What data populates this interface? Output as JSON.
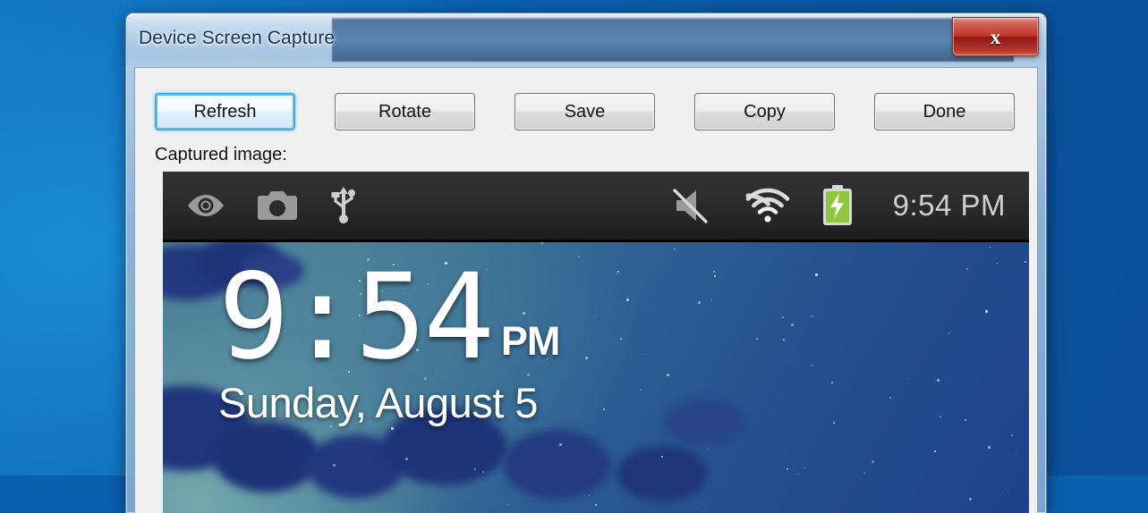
{
  "window": {
    "title": "Device Screen Capture",
    "close_label": "x",
    "close_icon": "close-icon"
  },
  "toolbar": {
    "buttons": [
      {
        "label": "Refresh",
        "default": true
      },
      {
        "label": "Rotate",
        "default": false
      },
      {
        "label": "Save",
        "default": false
      },
      {
        "label": "Copy",
        "default": false
      },
      {
        "label": "Done",
        "default": false
      }
    ]
  },
  "content": {
    "captured_label": "Captured image:"
  },
  "device": {
    "statusbar": {
      "left_icons": [
        "eye-icon",
        "camera-icon",
        "usb-icon"
      ],
      "right_icons": [
        "speaker-mute-icon",
        "wifi-icon",
        "battery-charging-icon"
      ],
      "clock": "9:54 PM"
    },
    "home": {
      "time": "9:54",
      "ampm": "PM",
      "date": "Sunday, August 5"
    }
  },
  "colors": {
    "desktop_blue": "#0a5fae",
    "titlebar_blue": "#34648f",
    "close_red": "#c0342a",
    "default_button_focus": "#4fc0f0",
    "client_gray": "#f0f0f0",
    "statusbar_dark": "#2a2a2a",
    "battery_green": "#8ec63f",
    "wallpaper_teal": "#4c7f92",
    "wallpaper_navy": "#1d428a"
  }
}
